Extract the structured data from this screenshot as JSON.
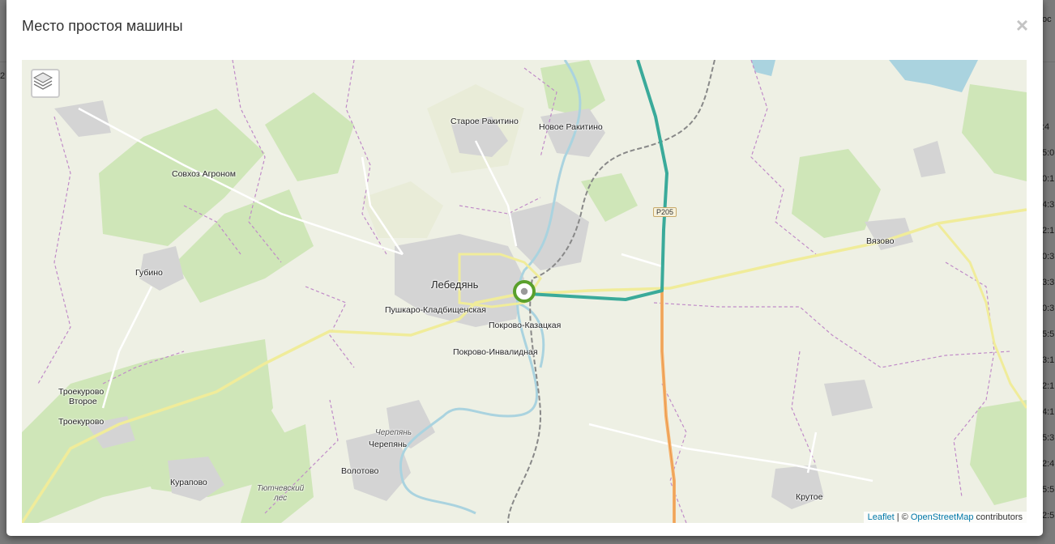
{
  "modal": {
    "title": "Место простоя машины",
    "close_label": "×"
  },
  "map": {
    "layers_icon": "layers-icon",
    "road_badge": "Р205",
    "labels": {
      "staroe_rakitino": "Старое Ракитино",
      "novoe_rakitino": "Новое Ракитино",
      "sovhoz_agronom": "Совхоз Агроном",
      "gubino": "Губино",
      "lebedyan": "Лебедянь",
      "pushkaro": "Пушкаро-Кладбищенская",
      "pokrovo_kazatskaya": "Покрово-Казацкая",
      "pokrovo_invalidnaya": "Покрово-Инвалидная",
      "vyazovo": "Вязово",
      "troekurovo_vtoroe_1": "Троекурово",
      "troekurovo_vtoroe_2": "Второе",
      "troekurovo": "Троекурово",
      "cherepyan_river": "Черепянь",
      "cherepyan": "Черепянь",
      "volotovo": "Волотово",
      "kurapovo": "Курапово",
      "tyutchevskiy_1": "Тютчевский",
      "tyutchevskiy_2": "лес",
      "krutoe": "Крутое"
    },
    "attribution": {
      "leaflet": "Leaflet",
      "separator": " | © ",
      "osm": "OpenStreetMap",
      "contributors": " contributors"
    },
    "colors": {
      "route": "#3aaa9a",
      "marker": "#5aa02c",
      "forest": "#c9e4b0",
      "water": "#aad3df"
    }
  },
  "background": {
    "right_times": [
      ":4",
      "5:0",
      "0:1",
      "4:3",
      "2:1",
      "0:3",
      "3:3",
      "0:3",
      "5:5",
      "3:1",
      "2:1",
      "4:1",
      "5:3",
      "2:4",
      "5:5",
      "2:5"
    ],
    "left_marks": [
      "2"
    ],
    "top_right_text": "ос"
  }
}
